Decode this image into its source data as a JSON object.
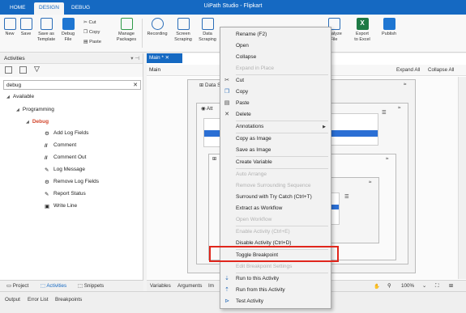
{
  "titlebar": {
    "tabs": [
      "HOME",
      "DESIGN",
      "DEBUG"
    ],
    "title": "UiPath Studio - Flipkart"
  },
  "ribbon": {
    "new": "New",
    "save": "Save",
    "save_as_template": "Save as\nTemplate",
    "debug": "Debug\nFile",
    "cut": "Cut",
    "copy": "Copy",
    "paste": "Paste",
    "manage_packages": "Manage\nPackages",
    "recording": "Recording",
    "screen_scraping": "Screen\nScraping",
    "data_scraping": "Data\nScraping",
    "analyze_file": "Analyze\nFile",
    "export_excel": "Export\nto Excel",
    "publish": "Publish"
  },
  "activities_panel": {
    "title": "Activities",
    "search_value": "debug",
    "tree": {
      "available": "Available",
      "programming": "Programming",
      "debug": "Debug",
      "items": [
        "Add Log Fields",
        "Comment",
        "Comment Out",
        "Log Message",
        "Remove Log Fields",
        "Report Status",
        "Write Line"
      ]
    }
  },
  "left_tabs": [
    "Project",
    "Activities",
    "Snippets"
  ],
  "status_tabs": [
    "Output",
    "Error List",
    "Breakpoints"
  ],
  "designer": {
    "doc_tab": "Main *",
    "breadcrumb": "Main",
    "expand_all": "Expand All",
    "collapse_all": "Collapse All",
    "data_scraping": "Data Sc",
    "attach": "Att",
    "bottom_tabs": [
      "Variables",
      "Arguments",
      "Im"
    ],
    "zoom": "100%"
  },
  "context_menu": {
    "items": [
      {
        "label": "Rename (F2)",
        "disabled": false,
        "icon": ""
      },
      {
        "label": "Open",
        "disabled": false,
        "icon": ""
      },
      {
        "label": "Collapse",
        "disabled": false,
        "icon": ""
      },
      {
        "label": "Expand in Place",
        "disabled": true,
        "icon": ""
      },
      {
        "label": "Cut",
        "disabled": false,
        "icon": "cut-icon"
      },
      {
        "label": "Copy",
        "disabled": false,
        "icon": "copy-icon"
      },
      {
        "label": "Paste",
        "disabled": false,
        "icon": "paste-icon"
      },
      {
        "label": "Delete",
        "disabled": false,
        "icon": "delete-icon"
      },
      {
        "label": "Annotations",
        "disabled": false,
        "icon": "",
        "submenu": true
      },
      {
        "label": "Copy as Image",
        "disabled": false,
        "icon": ""
      },
      {
        "label": "Save as Image",
        "disabled": false,
        "icon": ""
      },
      {
        "label": "Create Variable",
        "disabled": false,
        "icon": ""
      },
      {
        "label": "Auto Arrange",
        "disabled": true,
        "icon": ""
      },
      {
        "label": "Remove Surrounding Sequence",
        "disabled": true,
        "icon": ""
      },
      {
        "label": "Surround with Try Catch (Ctrl+T)",
        "disabled": false,
        "icon": ""
      },
      {
        "label": "Extract as Workflow",
        "disabled": false,
        "icon": ""
      },
      {
        "label": "Open Workflow",
        "disabled": true,
        "icon": ""
      },
      {
        "label": "Enable Activity (Ctrl+E)",
        "disabled": true,
        "icon": ""
      },
      {
        "label": "Disable Activity (Ctrl+D)",
        "disabled": false,
        "icon": ""
      },
      {
        "label": "Toggle Breakpoint",
        "disabled": false,
        "icon": ""
      },
      {
        "label": "Edit Breakpoint Settings",
        "disabled": true,
        "icon": ""
      },
      {
        "label": "Run to this Activity",
        "disabled": false,
        "icon": "run-to-icon"
      },
      {
        "label": "Run from this Activity",
        "disabled": false,
        "icon": "run-from-icon"
      },
      {
        "label": "Test Activity",
        "disabled": false,
        "icon": "test-icon"
      }
    ]
  },
  "colors": {
    "accent": "#1569c2",
    "highlight": "#e0261c",
    "category": "#d2462c"
  }
}
